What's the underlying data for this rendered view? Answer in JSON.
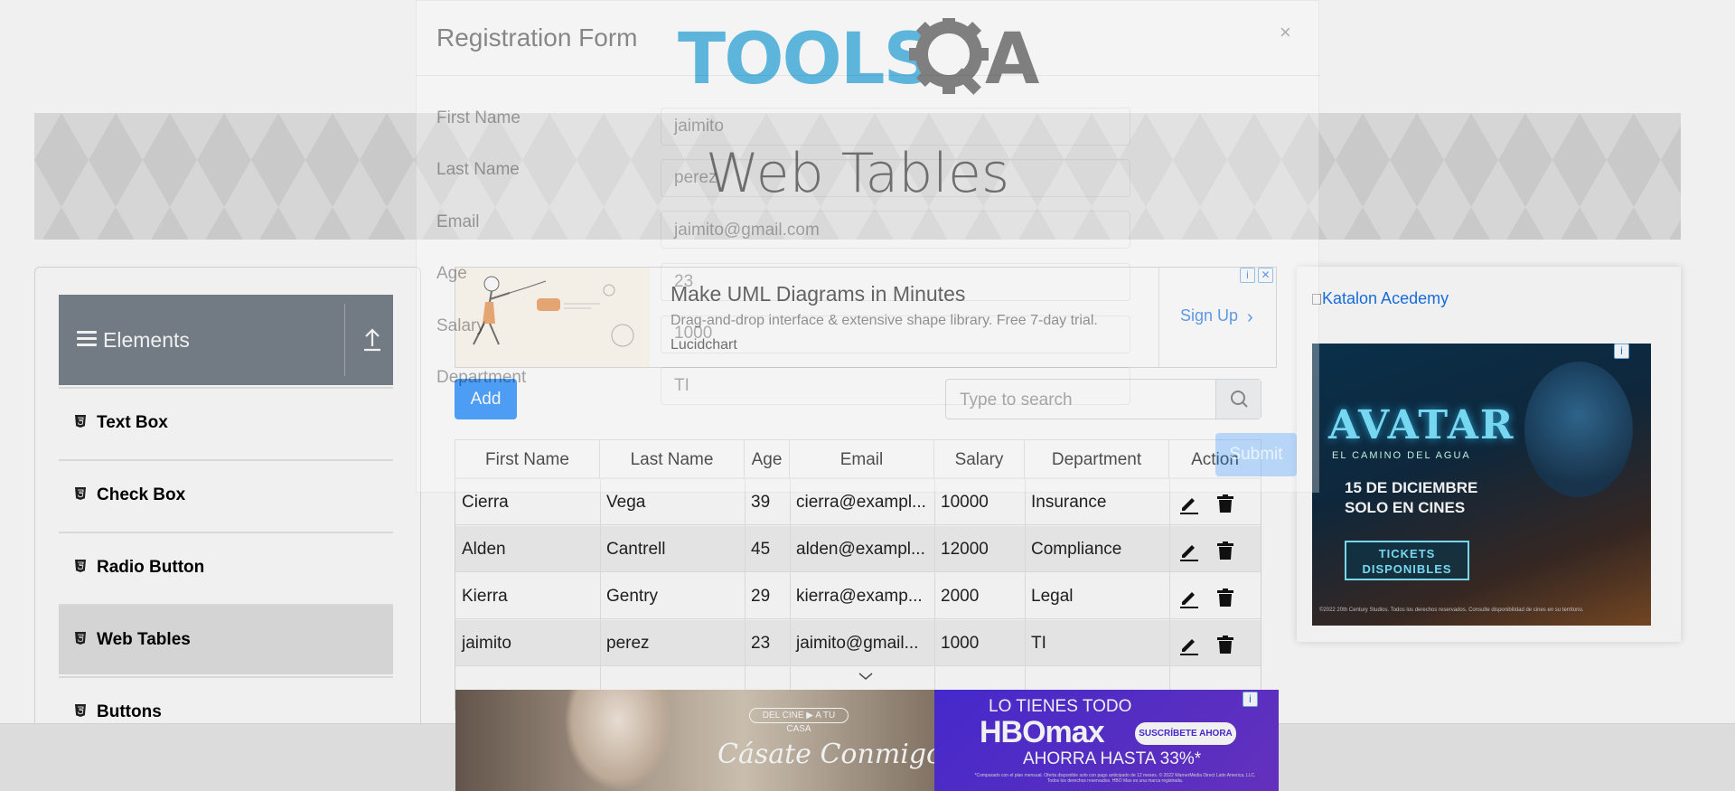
{
  "header": {
    "logo_text": "TOOLSQA",
    "page_title": "Web Tables"
  },
  "sidebar": {
    "group_title": "Elements",
    "items": [
      {
        "label": "Text Box"
      },
      {
        "label": "Check Box"
      },
      {
        "label": "Radio Button"
      },
      {
        "label": "Web Tables",
        "active": true
      },
      {
        "label": "Buttons"
      }
    ]
  },
  "ad_top": {
    "title": "Make UML Diagrams in Minutes",
    "description": "Drag-and-drop interface & extensive shape library. Free 7-day trial.",
    "brand": "Lucidchart",
    "cta": "Sign Up"
  },
  "toolbar": {
    "add_label": "Add",
    "search_placeholder": "Type to search"
  },
  "table": {
    "columns": [
      "First Name",
      "Last Name",
      "Age",
      "Email",
      "Salary",
      "Department",
      "Action"
    ],
    "rows": [
      {
        "first": "Cierra",
        "last": "Vega",
        "age": "39",
        "email": "cierra@exampl...",
        "salary": "10000",
        "dept": "Insurance"
      },
      {
        "first": "Alden",
        "last": "Cantrell",
        "age": "45",
        "email": "alden@exampl...",
        "salary": "12000",
        "dept": "Compliance"
      },
      {
        "first": "Kierra",
        "last": "Gentry",
        "age": "29",
        "email": "kierra@examp...",
        "salary": "2000",
        "dept": "Legal"
      },
      {
        "first": "jaimito",
        "last": "perez",
        "age": "23",
        "email": "jaimito@gmail...",
        "salary": "1000",
        "dept": "TI"
      }
    ]
  },
  "ad_right": {
    "broken_image_alt": "Katalon Acedemy",
    "avatar_title": "AVATAR",
    "avatar_subtitle": "EL CAMINO DEL AGUA",
    "avatar_date": "15 DE DICIEMBRE",
    "avatar_cinemas": "SOLO EN CINES",
    "avatar_tickets": "TICKETS DISPONIBLES",
    "avatar_legal": "©2022 20th Century Studios. Todos los derechos reservados. Consulte disponibilidad de cines en su territorio."
  },
  "ad_bottom": {
    "badge": "DEL CINE ▶ A TU CASA",
    "movie": "Cásate Conmigo",
    "tagline": "LO TIENES TODO",
    "brand": "HBOmax",
    "subscribe": "SUSCRÍBETE AHORA",
    "offer": "AHORRA HASTA 33%*",
    "fine_print": "*Comparado con el plan mensual. Oferta disponible solo con pago anticipado de 12 meses. © 2022 WarnerMedia Direct Latin America, LLC. Todos los derechos reservados. HBO Max es una marca registrada."
  },
  "modal": {
    "title": "Registration Form",
    "close": "×",
    "fields": [
      {
        "label": "First Name",
        "value": "jaimito"
      },
      {
        "label": "Last Name",
        "value": "perez"
      },
      {
        "label": "Email",
        "value": "jaimito@gmail.com"
      },
      {
        "label": "Age",
        "value": "23"
      },
      {
        "label": "Salary",
        "value": "1000"
      },
      {
        "label": "Department",
        "value": "TI"
      }
    ],
    "submit": "Submit"
  },
  "colors": {
    "primary": "#007bff",
    "sidebar_header": "#7a838c",
    "logo_blue": "#1a9fd9",
    "logo_gray": "#4d4d4d"
  }
}
